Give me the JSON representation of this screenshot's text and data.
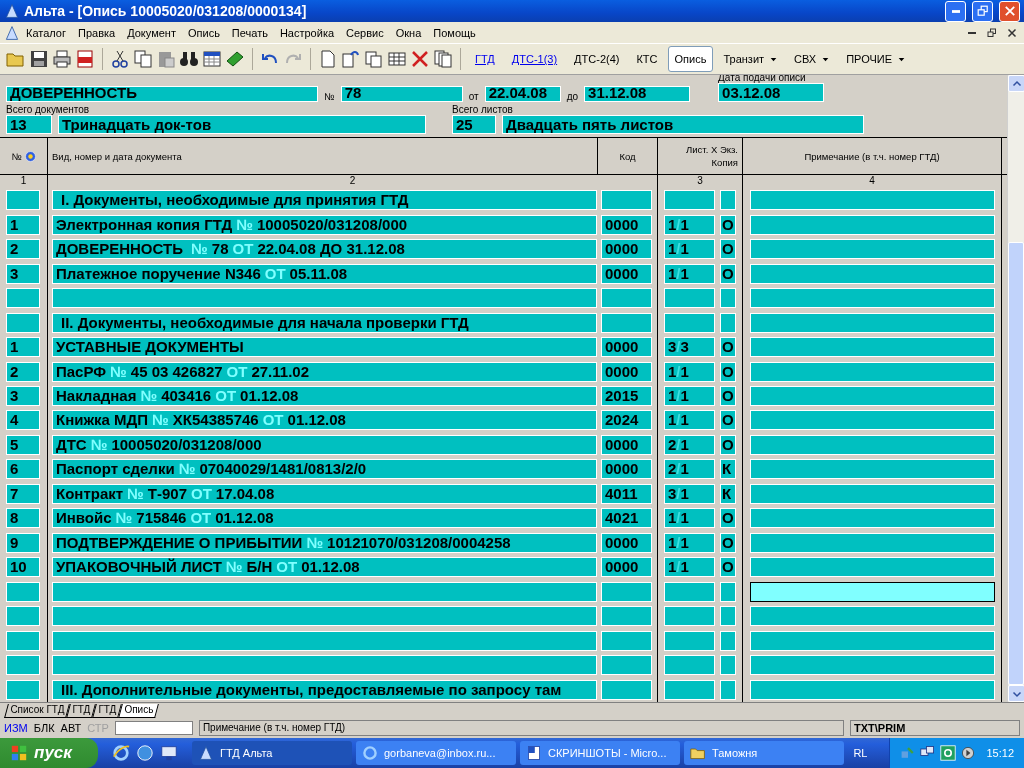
{
  "window": {
    "title": "Альта - [Опись 10005020/031208/0000134]"
  },
  "menu": [
    "Каталог",
    "Правка",
    "Документ",
    "Опись",
    "Печать",
    "Настройка",
    "Сервис",
    "Окна",
    "Помощь"
  ],
  "doc_tabs": [
    {
      "label": "ГТД",
      "kind": "link",
      "selected": false
    },
    {
      "label": "ДТС-1(3)",
      "kind": "link",
      "selected": false
    },
    {
      "label": "ДТС-2(4)",
      "kind": "plain",
      "selected": false
    },
    {
      "label": "КТС",
      "kind": "plain",
      "selected": false
    },
    {
      "label": "Опись",
      "kind": "plain",
      "selected": true
    },
    {
      "label": "Транзит",
      "kind": "dropdown",
      "selected": false
    },
    {
      "label": "СВХ",
      "kind": "dropdown",
      "selected": false
    },
    {
      "label": "ПРОЧИЕ",
      "kind": "dropdown",
      "selected": false
    }
  ],
  "header": {
    "doc_name": "ДОВЕРЕННОСТЬ",
    "number_label": "№",
    "number": "78",
    "from_label": "от",
    "from": "22.04.08",
    "to_label": "до",
    "to": "31.12.08",
    "date_label": "Дата подачи описи",
    "date": "03.12.08",
    "docs_label": "Всего документов",
    "docs_count": "13",
    "docs_words": "Тринадцать док-тов",
    "sheets_label": "Всего листов",
    "sheets_count": "25",
    "sheets_words": "Двадцать пять листов"
  },
  "table": {
    "columns": [
      "№",
      "Вид, номер и дата документа",
      "Код",
      "Лист. X Экз.",
      "Копия",
      "Примечание (в т.ч. номер ГТД)"
    ],
    "column_numbers": [
      "1",
      "2",
      "3",
      "4"
    ],
    "separator": "/",
    "rows": [
      {
        "kind": "section",
        "text": "I. Документы, необходимые для принятия ГТД"
      },
      {
        "kind": "document",
        "num": "1",
        "parts": [
          {
            "text": "Электронная копия ГТД",
            "label": false
          },
          {
            "text": "№",
            "label": true
          },
          {
            "text": "10005020/031208/000",
            "label": false
          }
        ],
        "code": "0000",
        "sheets": "1",
        "copies": "1",
        "copy_type": "О"
      },
      {
        "kind": "document",
        "num": "2",
        "parts": [
          {
            "text": "ДОВЕРЕННОСТЬ ",
            "label": false
          },
          {
            "text": "№",
            "label": true
          },
          {
            "text": "78",
            "label": false
          },
          {
            "text": "ОТ",
            "label": true
          },
          {
            "text": "22.04.08",
            "label": false
          },
          {
            "text": "ДО",
            "label": false
          },
          {
            "text": "31.12.08",
            "label": false
          }
        ],
        "code": "0000",
        "sheets": "1",
        "copies": "1",
        "copy_type": "О"
      },
      {
        "kind": "document",
        "num": "3",
        "parts": [
          {
            "text": "Платежное поручение N346",
            "label": false
          },
          {
            "text": "ОТ",
            "label": true
          },
          {
            "text": "05.11.08",
            "label": false
          }
        ],
        "code": "0000",
        "sheets": "1",
        "copies": "1",
        "copy_type": "О"
      },
      {
        "kind": "empty"
      },
      {
        "kind": "section",
        "text": "II. Документы, необходимые для начала проверки ГТД"
      },
      {
        "kind": "document",
        "num": "1",
        "parts": [
          {
            "text": "УСТАВНЫЕ ДОКУМЕНТЫ",
            "label": false
          }
        ],
        "code": "0000",
        "sheets": "3",
        "copies": "3",
        "copy_type": "О"
      },
      {
        "kind": "document",
        "num": "2",
        "parts": [
          {
            "text": "ПасРФ",
            "label": false
          },
          {
            "text": "№",
            "label": true
          },
          {
            "text": "45 03 426827",
            "label": false
          },
          {
            "text": "ОТ",
            "label": true
          },
          {
            "text": "27.11.02",
            "label": false
          }
        ],
        "code": "0000",
        "sheets": "1",
        "copies": "1",
        "copy_type": "О"
      },
      {
        "kind": "document",
        "num": "3",
        "parts": [
          {
            "text": "Накладная",
            "label": false
          },
          {
            "text": "№",
            "label": true
          },
          {
            "text": "403416",
            "label": false
          },
          {
            "text": "ОТ",
            "label": true
          },
          {
            "text": "01.12.08",
            "label": false
          }
        ],
        "code": "2015",
        "sheets": "1",
        "copies": "1",
        "copy_type": "О"
      },
      {
        "kind": "document",
        "num": "4",
        "parts": [
          {
            "text": "Книжка МДП",
            "label": false
          },
          {
            "text": "№",
            "label": true
          },
          {
            "text": "ХК54385746",
            "label": false
          },
          {
            "text": "ОТ",
            "label": true
          },
          {
            "text": "01.12.08",
            "label": false
          }
        ],
        "code": "2024",
        "sheets": "1",
        "copies": "1",
        "copy_type": "О"
      },
      {
        "kind": "document",
        "num": "5",
        "parts": [
          {
            "text": "ДТС",
            "label": false
          },
          {
            "text": "№",
            "label": true
          },
          {
            "text": "10005020/031208/000",
            "label": false
          }
        ],
        "code": "0000",
        "sheets": "2",
        "copies": "1",
        "copy_type": "О"
      },
      {
        "kind": "document",
        "num": "6",
        "parts": [
          {
            "text": "Паспорт сделки",
            "label": false
          },
          {
            "text": "№",
            "label": true
          },
          {
            "text": "07040029/1481/0813/2/0",
            "label": false
          }
        ],
        "code": "0000",
        "sheets": "2",
        "copies": "1",
        "copy_type": "К"
      },
      {
        "kind": "document",
        "num": "7",
        "parts": [
          {
            "text": "Контракт",
            "label": false
          },
          {
            "text": "№",
            "label": true
          },
          {
            "text": "Т-907",
            "label": false
          },
          {
            "text": "ОТ",
            "label": true
          },
          {
            "text": "17.04.08",
            "label": false
          }
        ],
        "code": "4011",
        "sheets": "3",
        "copies": "1",
        "copy_type": "К"
      },
      {
        "kind": "document",
        "num": "8",
        "parts": [
          {
            "text": "Инвойс",
            "label": false
          },
          {
            "text": "№",
            "label": true
          },
          {
            "text": "715846",
            "label": false
          },
          {
            "text": "ОТ",
            "label": true
          },
          {
            "text": "01.12.08",
            "label": false
          }
        ],
        "code": "4021",
        "sheets": "1",
        "copies": "1",
        "copy_type": "О"
      },
      {
        "kind": "document",
        "num": "9",
        "parts": [
          {
            "text": "ПОДТВЕРЖДЕНИЕ О ПРИБЫТИИ",
            "label": false
          },
          {
            "text": "№",
            "label": true
          },
          {
            "text": "10121070/031208/0004258",
            "label": false
          }
        ],
        "code": "0000",
        "sheets": "1",
        "copies": "1",
        "copy_type": "О"
      },
      {
        "kind": "document",
        "num": "10",
        "parts": [
          {
            "text": "УПАКОВОЧНЫЙ ЛИСТ",
            "label": false
          },
          {
            "text": "№",
            "label": true
          },
          {
            "text": "Б/Н",
            "label": false
          },
          {
            "text": "ОТ",
            "label": true
          },
          {
            "text": "01.12.08",
            "label": false
          }
        ],
        "code": "0000",
        "sheets": "1",
        "copies": "1",
        "copy_type": "О"
      },
      {
        "kind": "empty",
        "focused": true
      },
      {
        "kind": "empty"
      },
      {
        "kind": "empty"
      },
      {
        "kind": "empty"
      },
      {
        "kind": "section",
        "text": "III. Дополнительные документы, предоставляемые по запросу там"
      }
    ]
  },
  "sheet_tabs": [
    {
      "label": "Список ГТД",
      "selected": false
    },
    {
      "label": "ГТД",
      "selected": false
    },
    {
      "label": "ГТД",
      "selected": false
    },
    {
      "label": "Опись",
      "selected": true
    }
  ],
  "status_bar": {
    "modes": [
      {
        "label": "ИЗМ",
        "on": true,
        "disabled": false
      },
      {
        "label": "БЛК",
        "on": false,
        "disabled": false
      },
      {
        "label": "АВТ",
        "on": false,
        "disabled": false
      },
      {
        "label": "СТР",
        "on": false,
        "disabled": true
      }
    ],
    "hint": "Примечание (в т.ч. номер ГТД)",
    "field": "TXT\\PRIM"
  },
  "taskbar": {
    "start": "пуск",
    "tasks": [
      {
        "label": "ГТД Альта",
        "selected": true
      },
      {
        "label": "gorbaneva@inbox.ru...",
        "selected": false
      },
      {
        "label": "СКРИНШОТЫ - Micro...",
        "selected": false
      },
      {
        "label": "Таможня",
        "selected": false
      }
    ],
    "language": "RL",
    "time": "15:12"
  }
}
